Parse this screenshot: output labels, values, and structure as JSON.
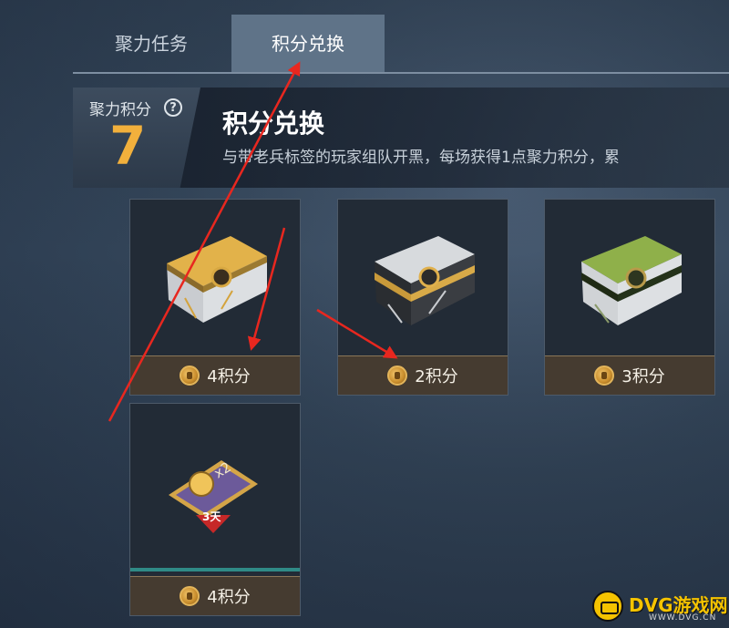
{
  "tabs": [
    {
      "label": "聚力任务",
      "active": false
    },
    {
      "label": "积分兑换",
      "active": true
    }
  ],
  "points": {
    "label": "聚力积分",
    "value": "7"
  },
  "header": {
    "title": "积分兑换",
    "description": "与带老兵标签的玩家组队开黑，每场获得1点聚力积分，累"
  },
  "rewards": [
    {
      "item": "gold-crate",
      "price": "4积分"
    },
    {
      "item": "silver-crate",
      "price": "2积分"
    },
    {
      "item": "green-crate",
      "price": "3积分"
    },
    {
      "item": "double-card",
      "badge": "3天",
      "multiplier": "x2",
      "price": "4积分"
    }
  ],
  "watermark": {
    "brand": "DVG游戏网",
    "url": "WWW.DVG.CN"
  },
  "colors": {
    "accent": "#f2b03c",
    "annotation_red": "#e8271f",
    "tab_active": "#5f7388"
  }
}
